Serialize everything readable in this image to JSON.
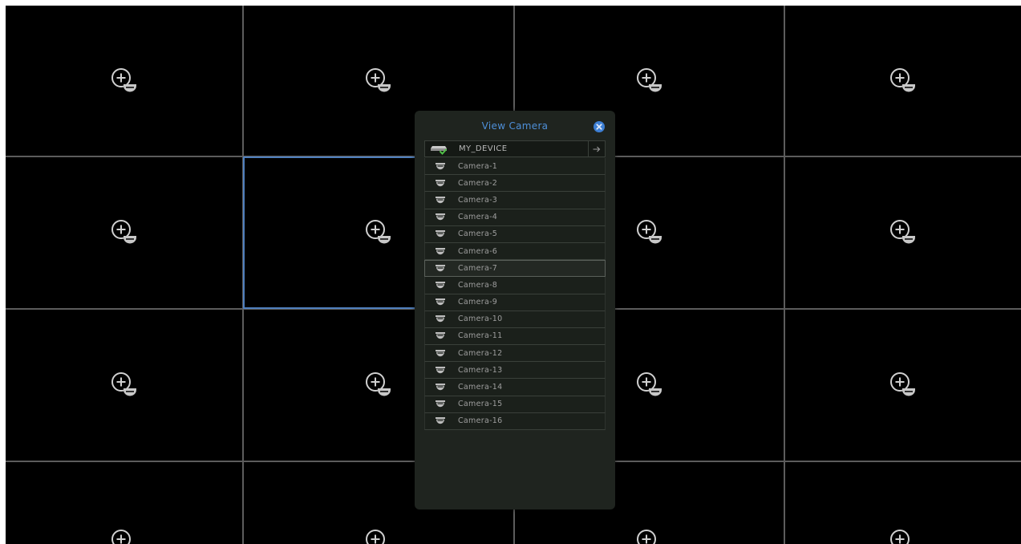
{
  "grid": {
    "rows": 4,
    "cols": 4,
    "selected_tile": 5,
    "line_color": "#5c5c5c",
    "selected_border_color": "#4f7fbd",
    "tile_icon": "add-camera-icon"
  },
  "popup": {
    "title": "View Camera",
    "close_icon": "close-icon",
    "device": {
      "label": "MY_DEVICE",
      "icon": "dvr-device-check-icon",
      "arrow_icon": "arrow-right-icon"
    },
    "cameras": [
      {
        "label": "Camera-1"
      },
      {
        "label": "Camera-2"
      },
      {
        "label": "Camera-3"
      },
      {
        "label": "Camera-4"
      },
      {
        "label": "Camera-5"
      },
      {
        "label": "Camera-6"
      },
      {
        "label": "Camera-7"
      },
      {
        "label": "Camera-8"
      },
      {
        "label": "Camera-9"
      },
      {
        "label": "Camera-10"
      },
      {
        "label": "Camera-11"
      },
      {
        "label": "Camera-12"
      },
      {
        "label": "Camera-13"
      },
      {
        "label": "Camera-14"
      },
      {
        "label": "Camera-15"
      },
      {
        "label": "Camera-16"
      }
    ],
    "hovered_index": 6,
    "camera_icon": "dome-camera-icon",
    "title_color": "#4e8fd8"
  }
}
